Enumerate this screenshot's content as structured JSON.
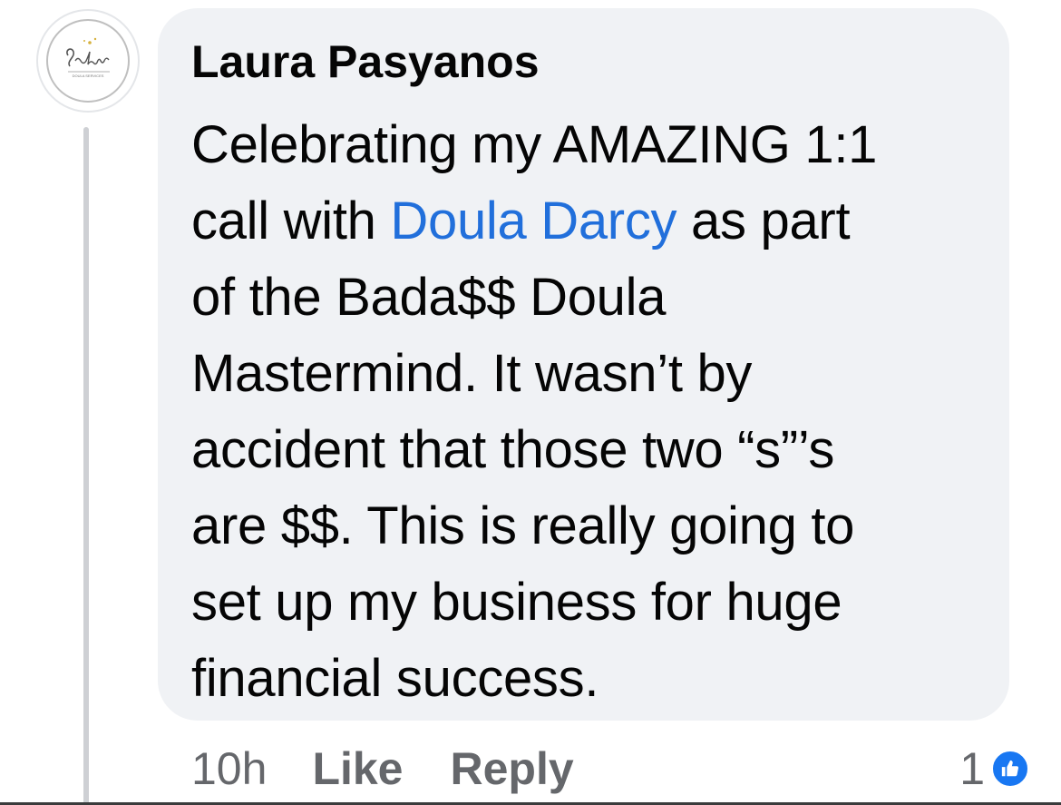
{
  "comment": {
    "author": "Laura Pasyanos",
    "avatar_logo_text": "Southern",
    "avatar_logo_subtext": "DOULA SERVICES",
    "body_lines": [
      {
        "before": "Celebrating my AMAZING 1:1",
        "mention": "",
        "after": ""
      },
      {
        "before": "call with ",
        "mention": "Doula Darcy",
        "after": " as part"
      },
      {
        "before": "of the Bada$$ Doula",
        "mention": "",
        "after": ""
      },
      {
        "before": "Mastermind. It wasn’t  by",
        "mention": "",
        "after": ""
      },
      {
        "before": "accident that those two “s”’s",
        "mention": "",
        "after": ""
      },
      {
        "before": "are $$. This is really going to",
        "mention": "",
        "after": ""
      },
      {
        "before": "set up my business for huge",
        "mention": "",
        "after": ""
      },
      {
        "before": "financial success.",
        "mention": "",
        "after": ""
      }
    ]
  },
  "actions": {
    "timestamp": "10h",
    "like_label": "Like",
    "reply_label": "Reply"
  },
  "reactions": {
    "count": "1",
    "icon": "thumbs-up-icon",
    "badge_color": "#1877f2"
  },
  "colors": {
    "bubble": "#f0f2f5",
    "mention": "#216fdb",
    "secondary_text": "#65676b"
  }
}
